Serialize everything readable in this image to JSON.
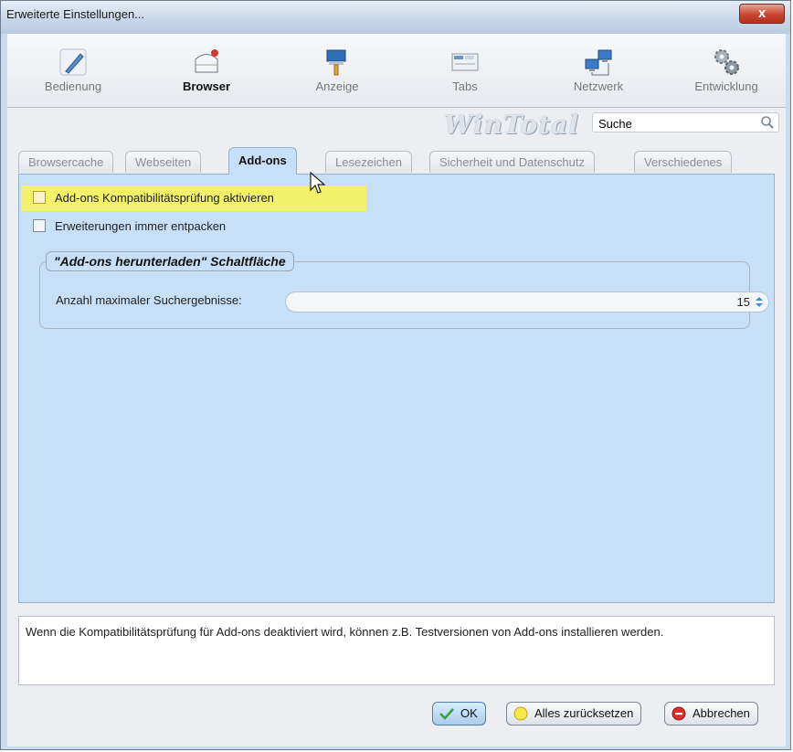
{
  "window": {
    "title": "Erweiterte Einstellungen...",
    "close_label": "x"
  },
  "toolbar": {
    "items": [
      {
        "label": "Bedienung",
        "icon": "pen-icon"
      },
      {
        "label": "Browser",
        "icon": "browser-icon"
      },
      {
        "label": "Anzeige",
        "icon": "paint-icon"
      },
      {
        "label": "Tabs",
        "icon": "tabs-icon"
      },
      {
        "label": "Netzwerk",
        "icon": "network-icon"
      },
      {
        "label": "Entwicklung",
        "icon": "gears-icon"
      }
    ],
    "active": "Browser"
  },
  "brand": "WinTotal",
  "search": {
    "value": "Suche"
  },
  "tabs": [
    "Browsercache",
    "Webseiten",
    "Add-ons",
    "Lesezeichen",
    "Sicherheit und Datenschutz",
    "Verschiedenes"
  ],
  "active_tab": "Add-ons",
  "options": [
    {
      "label": "Add-ons Kompatibilitätsprüfung aktivieren",
      "checked": false,
      "highlighted": true
    },
    {
      "label": "Erweiterungen immer entpacken",
      "checked": false
    }
  ],
  "group": {
    "legend": "\"Add-ons herunterladen\" Schaltfläche",
    "row_label": "Anzahl maximaler Suchergebnisse:",
    "value": "15"
  },
  "description": "Wenn die Kompatibilitätsprüfung für Add-ons deaktiviert wird, können z.B. Testversionen von Add-ons installieren werden.",
  "buttons": {
    "ok": "OK",
    "reset": "Alles zurücksetzen",
    "cancel": "Abbrechen"
  },
  "colors": {
    "highlight": "#f3f06a",
    "panel": "#c7e0f7",
    "close": "#c9452f"
  }
}
